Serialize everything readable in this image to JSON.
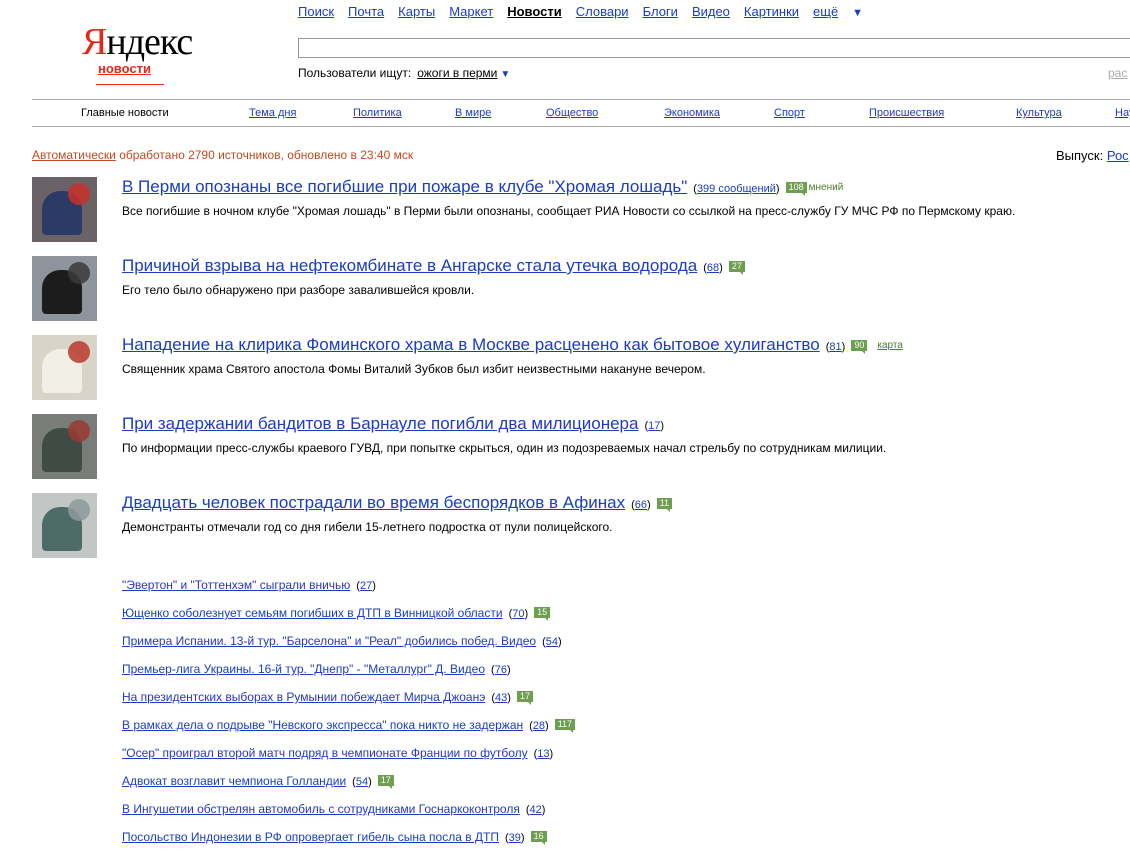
{
  "logo": {
    "ya": "Я",
    "rest": "ндекс",
    "sub": "новости"
  },
  "services": [
    {
      "label": "Поиск",
      "current": false
    },
    {
      "label": "Почта",
      "current": false
    },
    {
      "label": "Карты",
      "current": false
    },
    {
      "label": "Маркет",
      "current": false
    },
    {
      "label": "Новости",
      "current": true
    },
    {
      "label": "Словари",
      "current": false
    },
    {
      "label": "Блоги",
      "current": false
    },
    {
      "label": "Видео",
      "current": false
    },
    {
      "label": "Картинки",
      "current": false
    }
  ],
  "services_more": "ещё",
  "search": {
    "value": "",
    "users_label": "Пользователи ищут:",
    "users_query": "ожоги в перми",
    "advanced": "рас"
  },
  "categories": [
    {
      "label": "Главные новости",
      "current": true
    },
    {
      "label": "Тема дня"
    },
    {
      "label": "Политика"
    },
    {
      "label": "В мире"
    },
    {
      "label": "Общество"
    },
    {
      "label": "Экономика"
    },
    {
      "label": "Спорт"
    },
    {
      "label": "Происшествия"
    },
    {
      "label": "Культура"
    },
    {
      "label": "Нау"
    }
  ],
  "meta": {
    "auto_link": "Автоматически",
    "text": " обработано 2790 источников, обновлено в 23:40 мск"
  },
  "release": {
    "label": "Выпуск:",
    "value": "Рос"
  },
  "stories": [
    {
      "title": "В Перми опознаны все погибшие при пожаре в клубе \"Хромая лошадь\"",
      "count": "399 сообщений",
      "opinions": "108",
      "opinions_label": "мнений",
      "map": "",
      "annotation": "Все погибшие в ночном клубе \"Хромая лошадь\" в Перми были опознаны, сообщает РИА Новости со ссылкой на пресс-службу ГУ МЧС РФ по Пермскому краю.",
      "img": {
        "name": "story-photo-officials-meeting",
        "bg": "#6a6266",
        "accent": "#2b3a66",
        "accent2": "#c9302c"
      }
    },
    {
      "title": "Причиной взрыва на нефтекомбинате в Ангарске стала утечка водорода",
      "count": "68",
      "opinions": "27",
      "opinions_label": "",
      "map": "",
      "annotation": "Его тело было обнаружено при разборе завалившейся кровли.",
      "img": {
        "name": "story-photo-black-smoke",
        "bg": "#8d949c",
        "accent": "#1c1c1c",
        "accent2": "#3a3a3a"
      }
    },
    {
      "title": "Нападение на клирика Фоминского храма в Москве расценено как бытовое хулиганство",
      "count": "81",
      "opinions": "90",
      "opinions_label": "",
      "map": "карта",
      "annotation": "Священник храма Святого апостола Фомы Виталий Зубков был избит неизвестными накануне вечером.",
      "img": {
        "name": "story-photo-ambulance",
        "bg": "#d8d4c8",
        "accent": "#f2efe6",
        "accent2": "#b83a2e"
      }
    },
    {
      "title": "При задержании бандитов в Барнауле погибли два милиционера",
      "count": "17",
      "opinions": "",
      "opinions_label": "",
      "map": "",
      "annotation": "По информации пресс-службы краевого ГУВД, при попытке скрыться, один из подозреваемых начал стрельбу по сотрудникам милиции.",
      "img": {
        "name": "story-photo-police-officers",
        "bg": "#7a7c7a",
        "accent": "#3f4b44",
        "accent2": "#9a3a32"
      }
    },
    {
      "title": "Двадцать человек пострадали во время беспорядков в Афинах",
      "count": "66",
      "opinions": "11",
      "opinions_label": "",
      "map": "",
      "annotation": "Демонстранты отмечали год со дня гибели 15-летнего подростка от пули полицейского.",
      "img": {
        "name": "story-photo-medic",
        "bg": "#c2c6c4",
        "accent": "#4f6b68",
        "accent2": "#8d9a9a"
      }
    }
  ],
  "small_items": [
    {
      "title": "\"Эвертон\" и \"Тоттенхэм\" сыграли вничью",
      "count": "27",
      "opinions": ""
    },
    {
      "title": "Ющенко соболезнует семьям погибших в ДТП в Винницкой области",
      "count": "70",
      "opinions": "15"
    },
    {
      "title": "Примера Испании. 13-й тур. \"Барселона\" и \"Реал\" добились побед. Видео",
      "count": "54",
      "opinions": ""
    },
    {
      "title": "Премьер-лига Украины. 16-й тур. \"Днепр\" - \"Металлург\" Д. Видео",
      "count": "76",
      "opinions": ""
    },
    {
      "title": "На президентских выборах в Румынии побеждает Мирча Джоанэ",
      "count": "43",
      "opinions": "17"
    },
    {
      "title": "В рамках дела о подрыве \"Невского экспресса\" пока никто не задержан",
      "count": "28",
      "opinions": "117"
    },
    {
      "title": "\"Осер\" проиграл второй матч подряд в чемпионате Франции по футболу",
      "count": "13",
      "opinions": ""
    },
    {
      "title": "Адвокат возглавит чемпиона Голландии",
      "count": "54",
      "opinions": "17"
    },
    {
      "title": "В Ингушетии обстрелян автомобиль с сотрудниками Госнаркоконтроля",
      "count": "42",
      "opinions": ""
    },
    {
      "title": "Посольство Индонезии в РФ опровергает гибель сына посла в ДТП",
      "count": "39",
      "opinions": "16"
    }
  ]
}
